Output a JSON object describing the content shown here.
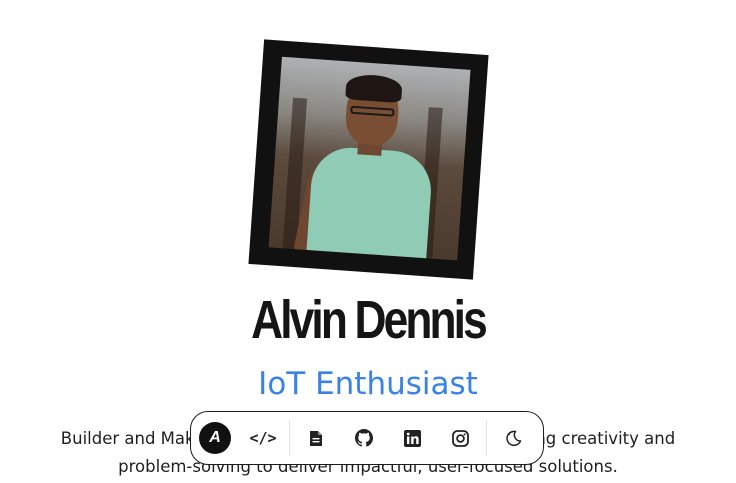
{
  "profile": {
    "name": "Alvin Dennis",
    "role": "IoT Enthusiast",
    "bio": "Builder and Maker with a passion for technology, combining creativity and problem-solving to deliver impactful, user-focused solutions.",
    "photo_alt": "Portrait of Alvin Dennis"
  },
  "dock": {
    "logo_text": "A",
    "items": [
      {
        "name": "code",
        "icon": "code-icon"
      },
      {
        "name": "resume",
        "icon": "document-icon"
      },
      {
        "name": "github",
        "icon": "github-icon"
      },
      {
        "name": "linkedin",
        "icon": "linkedin-icon"
      },
      {
        "name": "instagram",
        "icon": "instagram-icon"
      },
      {
        "name": "theme-toggle",
        "icon": "moon-icon"
      }
    ]
  },
  "colors": {
    "accent": "#3b82e6",
    "text": "#151515",
    "background": "#ffffff"
  }
}
